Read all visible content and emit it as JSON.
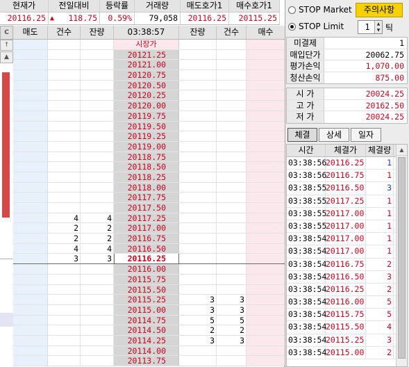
{
  "summary": {
    "headers": [
      "현재가",
      "전일대비",
      "등락률",
      "거래량",
      "매도호가1",
      "매수호가1"
    ],
    "current_price": "20116.25",
    "change_arrow": "▲",
    "change": "118.75",
    "change_rate": "0.59%",
    "volume": "79,058",
    "ask1": "20116.25",
    "bid1": "20115.25"
  },
  "book": {
    "side_controls": {
      "c": "C",
      "up": "↑",
      "tri": "▲"
    },
    "headers": [
      "매도",
      "건수",
      "잔량",
      "03:38:57",
      "잔량",
      "건수",
      "매수"
    ],
    "market_label": "시장가",
    "rows": [
      {
        "price": "20121.25",
        "ask_cnt": "",
        "ask_qty": "",
        "bid_qty": "",
        "bid_cnt": ""
      },
      {
        "price": "20121.00",
        "ask_cnt": "",
        "ask_qty": "",
        "bid_qty": "",
        "bid_cnt": ""
      },
      {
        "price": "20120.75",
        "ask_cnt": "",
        "ask_qty": "",
        "bid_qty": "",
        "bid_cnt": ""
      },
      {
        "price": "20120.50",
        "ask_cnt": "",
        "ask_qty": "",
        "bid_qty": "",
        "bid_cnt": ""
      },
      {
        "price": "20120.25",
        "ask_cnt": "",
        "ask_qty": "",
        "bid_qty": "",
        "bid_cnt": ""
      },
      {
        "price": "20120.00",
        "ask_cnt": "",
        "ask_qty": "",
        "bid_qty": "",
        "bid_cnt": ""
      },
      {
        "price": "20119.75",
        "ask_cnt": "",
        "ask_qty": "",
        "bid_qty": "",
        "bid_cnt": ""
      },
      {
        "price": "20119.50",
        "ask_cnt": "",
        "ask_qty": "",
        "bid_qty": "",
        "bid_cnt": ""
      },
      {
        "price": "20119.25",
        "ask_cnt": "",
        "ask_qty": "",
        "bid_qty": "",
        "bid_cnt": ""
      },
      {
        "price": "20119.00",
        "ask_cnt": "",
        "ask_qty": "",
        "bid_qty": "",
        "bid_cnt": ""
      },
      {
        "price": "20118.75",
        "ask_cnt": "",
        "ask_qty": "",
        "bid_qty": "",
        "bid_cnt": ""
      },
      {
        "price": "20118.50",
        "ask_cnt": "",
        "ask_qty": "",
        "bid_qty": "",
        "bid_cnt": ""
      },
      {
        "price": "20118.25",
        "ask_cnt": "",
        "ask_qty": "",
        "bid_qty": "",
        "bid_cnt": ""
      },
      {
        "price": "20118.00",
        "ask_cnt": "",
        "ask_qty": "",
        "bid_qty": "",
        "bid_cnt": ""
      },
      {
        "price": "20117.75",
        "ask_cnt": "",
        "ask_qty": "",
        "bid_qty": "",
        "bid_cnt": ""
      },
      {
        "price": "20117.50",
        "ask_cnt": "",
        "ask_qty": "",
        "bid_qty": "",
        "bid_cnt": ""
      },
      {
        "price": "20117.25",
        "ask_cnt": "4",
        "ask_qty": "4",
        "bid_qty": "",
        "bid_cnt": ""
      },
      {
        "price": "20117.00",
        "ask_cnt": "2",
        "ask_qty": "2",
        "bid_qty": "",
        "bid_cnt": ""
      },
      {
        "price": "20116.75",
        "ask_cnt": "2",
        "ask_qty": "2",
        "bid_qty": "",
        "bid_cnt": ""
      },
      {
        "price": "20116.50",
        "ask_cnt": "4",
        "ask_qty": "4",
        "bid_qty": "",
        "bid_cnt": ""
      },
      {
        "price": "20116.25",
        "ask_cnt": "3",
        "ask_qty": "3",
        "bid_qty": "",
        "bid_cnt": "",
        "current": true
      },
      {
        "price": "20116.00",
        "ask_cnt": "",
        "ask_qty": "",
        "bid_qty": "",
        "bid_cnt": ""
      },
      {
        "price": "20115.75",
        "ask_cnt": "",
        "ask_qty": "",
        "bid_qty": "",
        "bid_cnt": ""
      },
      {
        "price": "20115.50",
        "ask_cnt": "",
        "ask_qty": "",
        "bid_qty": "",
        "bid_cnt": ""
      },
      {
        "price": "20115.25",
        "ask_cnt": "",
        "ask_qty": "",
        "bid_qty": "3",
        "bid_cnt": "3"
      },
      {
        "price": "20115.00",
        "ask_cnt": "",
        "ask_qty": "",
        "bid_qty": "3",
        "bid_cnt": "3"
      },
      {
        "price": "20114.75",
        "ask_cnt": "",
        "ask_qty": "",
        "bid_qty": "5",
        "bid_cnt": "5"
      },
      {
        "price": "20114.50",
        "ask_cnt": "",
        "ask_qty": "",
        "bid_qty": "2",
        "bid_cnt": "2"
      },
      {
        "price": "20114.25",
        "ask_cnt": "",
        "ask_qty": "",
        "bid_qty": "3",
        "bid_cnt": "3"
      },
      {
        "price": "20114.00",
        "ask_cnt": "",
        "ask_qty": "",
        "bid_qty": "",
        "bid_cnt": ""
      },
      {
        "price": "20113.75",
        "ask_cnt": "",
        "ask_qty": "",
        "bid_qty": "",
        "bid_cnt": ""
      }
    ]
  },
  "panel": {
    "stop_market": "STOP Market",
    "stop_limit": "STOP Limit",
    "caution_button": "주의사항",
    "tick_value": "1",
    "tick_label": "틱",
    "position": [
      {
        "label": "미결제",
        "value": "1",
        "color": "black"
      },
      {
        "label": "매입단가",
        "value": "20062.75",
        "color": "black"
      },
      {
        "label": "평가손익",
        "value": "1,070.00",
        "color": "red"
      },
      {
        "label": "청산손익",
        "value": "875.00",
        "color": "red"
      }
    ],
    "ohlc": [
      {
        "label": "시 가",
        "value": "20024.25"
      },
      {
        "label": "고 가",
        "value": "20162.50"
      },
      {
        "label": "저 가",
        "value": "20024.25"
      }
    ],
    "tabs": [
      "체결",
      "상세",
      "일자"
    ],
    "trade_headers": [
      "시간",
      "체결가",
      "체결량"
    ],
    "trades": [
      {
        "time": "03:38:56",
        "price": "20116.25",
        "qty": "1",
        "qty_color": "blue"
      },
      {
        "time": "03:38:56",
        "price": "20116.75",
        "qty": "1",
        "qty_color": "red"
      },
      {
        "time": "03:38:55",
        "price": "20116.50",
        "qty": "3",
        "qty_color": "blue"
      },
      {
        "time": "03:38:55",
        "price": "20117.25",
        "qty": "1",
        "qty_color": "red"
      },
      {
        "time": "03:38:55",
        "price": "20117.00",
        "qty": "1",
        "qty_color": "red"
      },
      {
        "time": "03:38:55",
        "price": "20117.00",
        "qty": "1",
        "qty_color": "red"
      },
      {
        "time": "03:38:54",
        "price": "20117.00",
        "qty": "1",
        "qty_color": "red"
      },
      {
        "time": "03:38:54",
        "price": "20117.00",
        "qty": "1",
        "qty_color": "red"
      },
      {
        "time": "03:38:54",
        "price": "20116.75",
        "qty": "2",
        "qty_color": "red"
      },
      {
        "time": "03:38:54",
        "price": "20116.50",
        "qty": "3",
        "qty_color": "red"
      },
      {
        "time": "03:38:54",
        "price": "20116.25",
        "qty": "2",
        "qty_color": "red"
      },
      {
        "time": "03:38:54",
        "price": "20116.00",
        "qty": "5",
        "qty_color": "red"
      },
      {
        "time": "03:38:54",
        "price": "20115.75",
        "qty": "5",
        "qty_color": "red"
      },
      {
        "time": "03:38:54",
        "price": "20115.50",
        "qty": "4",
        "qty_color": "red"
      },
      {
        "time": "03:38:54",
        "price": "20115.25",
        "qty": "3",
        "qty_color": "red"
      },
      {
        "time": "03:38:54",
        "price": "20115.00",
        "qty": "2",
        "qty_color": "red"
      }
    ]
  },
  "colors": {
    "red": "#d0021b",
    "blue": "#1a3fd0",
    "caution_yellow": "#f5d100"
  }
}
